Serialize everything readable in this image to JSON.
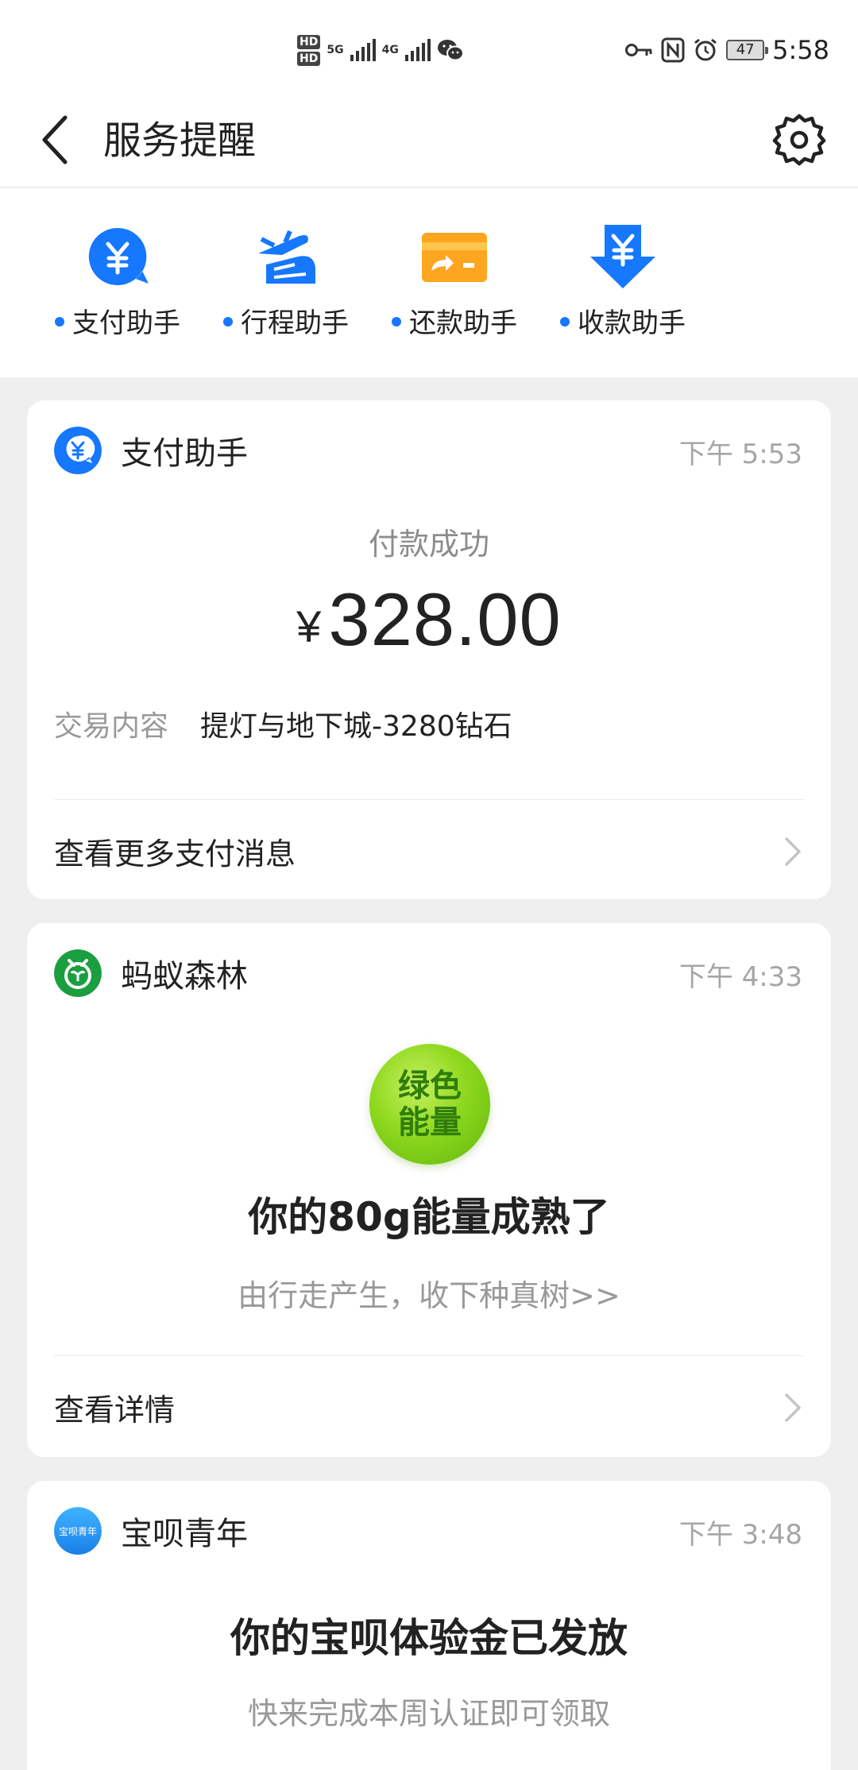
{
  "status_bar": {
    "hd1": "HD",
    "hd2": "HD",
    "net1": "5G",
    "net2": "4G",
    "battery": "47",
    "time": "5:58"
  },
  "header": {
    "title": "服务提醒"
  },
  "shortcuts": [
    {
      "label": "支付助手",
      "icon": "pay-assistant-icon",
      "color": "#1677ff"
    },
    {
      "label": "行程助手",
      "icon": "trip-assistant-icon",
      "color": "#1677ff"
    },
    {
      "label": "还款助手",
      "icon": "repay-assistant-icon",
      "color": "#ffa51f"
    },
    {
      "label": "收款助手",
      "icon": "receive-assistant-icon",
      "color": "#1677ff"
    }
  ],
  "cards": {
    "payment": {
      "name": "支付助手",
      "time": "下午 5:53",
      "status": "付款成功",
      "currency": "¥",
      "amount": "328.00",
      "detail_label": "交易内容",
      "detail_value": "提灯与地下城-3280钻石",
      "link": "查看更多支付消息"
    },
    "forest": {
      "name": "蚂蚁森林",
      "time": "下午 4:33",
      "badge_line1": "绿色",
      "badge_line2": "能量",
      "title": "你的80g能量成熟了",
      "subtitle": "由行走产生，收下种真树>>",
      "link": "查看详情"
    },
    "baobei": {
      "name": "宝呗青年",
      "avatar_text": "宝呗青年",
      "time": "下午 3:48",
      "title": "你的宝呗体验金已发放",
      "subtitle": "快来完成本周认证即可领取"
    }
  },
  "colors": {
    "accent": "#1677ff",
    "forest_green": "#1a9e3f",
    "muted_text": "#999999"
  }
}
